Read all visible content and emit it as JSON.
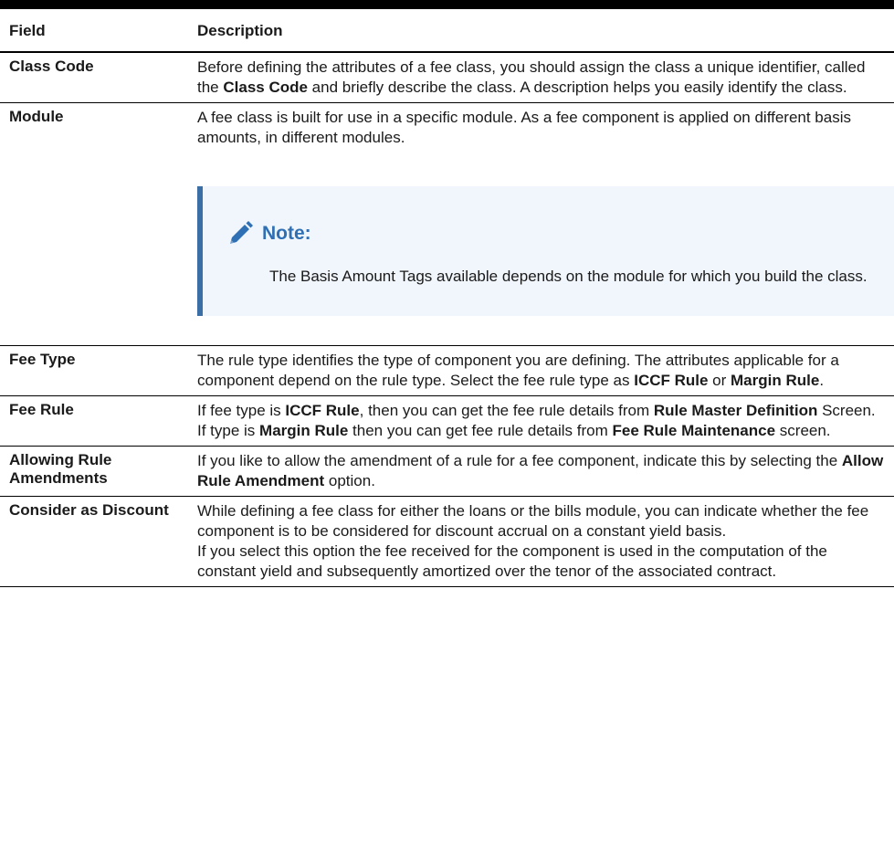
{
  "header": {
    "field": "Field",
    "description": "Description"
  },
  "rows": {
    "class_code": {
      "field": "Class Code",
      "d1": "Before defining the attributes of a fee class, you should assign the class a unique identifier, called the ",
      "d2": "Class Code",
      "d3": " and briefly describe the class. A description helps you easily identify the class."
    },
    "module": {
      "field": "Module",
      "d1": "A fee class is built for use in a specific module. As a fee component is applied on different basis amounts, in different modules.",
      "note_title": "Note:",
      "note_text": "The Basis Amount Tags available depends on the module for which you build the class."
    },
    "fee_type": {
      "field": "Fee Type",
      "d1": "The rule type identifies the type of component you are defining. The attributes applicable for a component depend on the rule type. Select the fee rule type as ",
      "d2": "ICCF Rule",
      "d3": " or ",
      "d4": "Margin Rule",
      "d5": "."
    },
    "fee_rule": {
      "field": "Fee Rule",
      "d1": "If fee type is ",
      "d2": "ICCF Rule",
      "d3": ", then you can get the fee rule details from ",
      "d4": "Rule Master Definition",
      "d5": " Screen. If type is ",
      "d6": "Margin Rule",
      "d7": " then you can get fee rule details from ",
      "d8": "Fee Rule Maintenance",
      "d9": " screen."
    },
    "allowing_rule": {
      "field": "Allowing Rule Amendments",
      "d1": "If you like to allow the amendment of a rule for a fee component, indicate this by selecting the ",
      "d2": "Allow Rule Amendment",
      "d3": " option."
    },
    "consider_discount": {
      "field": "Consider as Discount",
      "p1": "While defining a fee class for either the loans or the bills module, you can indicate whether the fee component is to be considered for discount accrual on a constant yield basis.",
      "p2": "If you select this option the fee received for the component is used in the computation of the constant yield and subsequently amortized over the tenor of the associated contract."
    }
  },
  "icons": {
    "note": "pencil-icon"
  },
  "colors": {
    "note_accent": "#3b6ea5",
    "note_title": "#2f6fb3",
    "note_bg": "#f1f6fc"
  }
}
